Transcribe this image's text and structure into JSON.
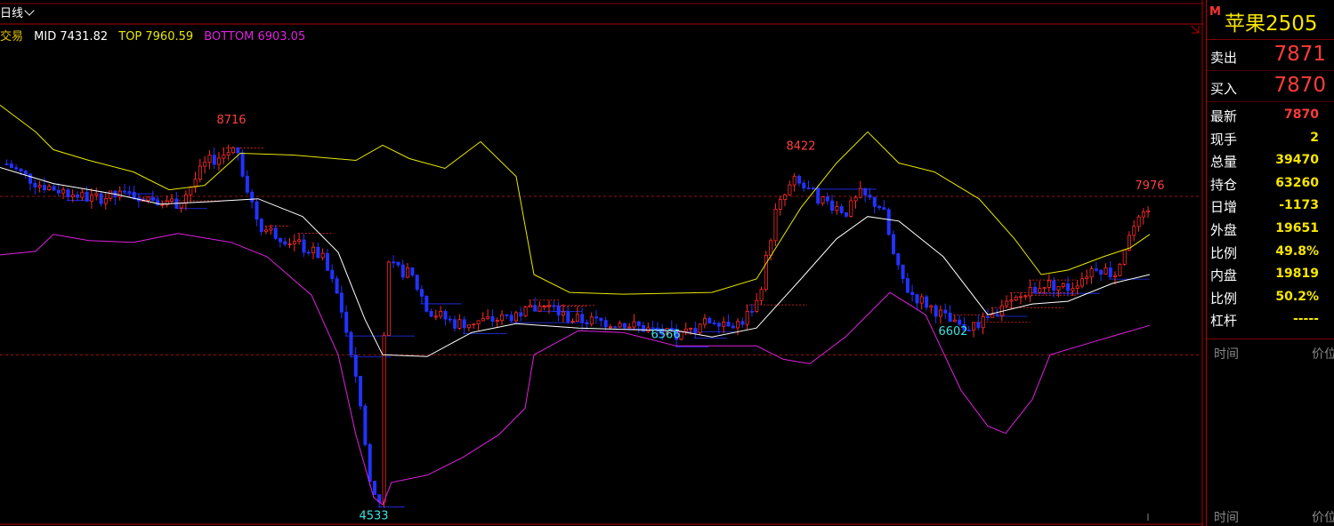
{
  "toolbar": {
    "period_label": "日线"
  },
  "legend": {
    "name": "交易",
    "mid": "MID 7431.82",
    "top": "TOP 7960.59",
    "bottom": "BOTTOM 6903.05",
    "colors": {
      "name": "#e0c000",
      "mid": "#ffffff",
      "top": "#e8e800",
      "bottom": "#e020e0"
    }
  },
  "chart_data": {
    "type": "candlestick",
    "indicator": "BOLL",
    "ylim": [
      4400,
      9700
    ],
    "price_lines": [
      7976,
      6200
    ],
    "candle_colors": {
      "up": "#ff2a2a",
      "down": "#2233ff"
    },
    "annotations": [
      {
        "label": "8716",
        "x": 260,
        "value": 8716,
        "color": "#ff4040"
      },
      {
        "label": "4533",
        "x": 420,
        "value": 4533,
        "color": "#40e0e0"
      },
      {
        "label": "6566",
        "x": 748,
        "value": 6566,
        "color": "#40e0e0"
      },
      {
        "label": "8422",
        "x": 900,
        "value": 8422,
        "color": "#ff4040"
      },
      {
        "label": "6602",
        "x": 1071,
        "value": 6602,
        "color": "#40e0e0"
      },
      {
        "label": "7976",
        "x": 1292,
        "value": 7976,
        "color": "#ff4040"
      }
    ],
    "close": [
      [
        0,
        8380
      ],
      [
        40,
        8120
      ],
      [
        100,
        7950
      ],
      [
        150,
        8000
      ],
      [
        200,
        7900
      ],
      [
        230,
        8350
      ],
      [
        265,
        8520
      ],
      [
        275,
        8100
      ],
      [
        290,
        7650
      ],
      [
        330,
        7450
      ],
      [
        360,
        7300
      ],
      [
        380,
        6800
      ],
      [
        400,
        5900
      ],
      [
        415,
        4700
      ],
      [
        425,
        4550
      ],
      [
        432,
        7200
      ],
      [
        460,
        7100
      ],
      [
        480,
        6700
      ],
      [
        510,
        6550
      ],
      [
        560,
        6600
      ],
      [
        610,
        6750
      ],
      [
        640,
        6600
      ],
      [
        700,
        6550
      ],
      [
        740,
        6450
      ],
      [
        760,
        6400
      ],
      [
        800,
        6600
      ],
      [
        830,
        6550
      ],
      [
        850,
        6800
      ],
      [
        870,
        7800
      ],
      [
        890,
        8150
      ],
      [
        920,
        7950
      ],
      [
        950,
        7800
      ],
      [
        965,
        8000
      ],
      [
        990,
        7850
      ],
      [
        1005,
        7200
      ],
      [
        1020,
        6900
      ],
      [
        1050,
        6700
      ],
      [
        1075,
        6500
      ],
      [
        1100,
        6550
      ],
      [
        1130,
        6750
      ],
      [
        1170,
        7000
      ],
      [
        1200,
        6950
      ],
      [
        1230,
        7200
      ],
      [
        1250,
        7100
      ],
      [
        1270,
        7600
      ],
      [
        1290,
        7800
      ]
    ],
    "boll_top": [
      [
        0,
        9000
      ],
      [
        40,
        8700
      ],
      [
        60,
        8500
      ],
      [
        100,
        8380
      ],
      [
        150,
        8250
      ],
      [
        190,
        8050
      ],
      [
        230,
        8100
      ],
      [
        270,
        8460
      ],
      [
        330,
        8440
      ],
      [
        400,
        8380
      ],
      [
        430,
        8550
      ],
      [
        460,
        8400
      ],
      [
        500,
        8290
      ],
      [
        540,
        8590
      ],
      [
        580,
        8200
      ],
      [
        600,
        7100
      ],
      [
        640,
        6900
      ],
      [
        700,
        6880
      ],
      [
        800,
        6900
      ],
      [
        850,
        7050
      ],
      [
        900,
        7850
      ],
      [
        940,
        8350
      ],
      [
        975,
        8700
      ],
      [
        1010,
        8350
      ],
      [
        1050,
        8250
      ],
      [
        1100,
        7950
      ],
      [
        1140,
        7500
      ],
      [
        1170,
        7100
      ],
      [
        1200,
        7150
      ],
      [
        1240,
        7300
      ],
      [
        1270,
        7400
      ],
      [
        1292,
        7550
      ]
    ],
    "boll_mid": [
      [
        0,
        8300
      ],
      [
        60,
        8120
      ],
      [
        130,
        8000
      ],
      [
        180,
        7890
      ],
      [
        240,
        7920
      ],
      [
        290,
        7950
      ],
      [
        340,
        7750
      ],
      [
        380,
        7350
      ],
      [
        410,
        6600
      ],
      [
        430,
        6200
      ],
      [
        480,
        6180
      ],
      [
        530,
        6450
      ],
      [
        580,
        6550
      ],
      [
        650,
        6500
      ],
      [
        720,
        6480
      ],
      [
        760,
        6470
      ],
      [
        800,
        6400
      ],
      [
        850,
        6500
      ],
      [
        900,
        7050
      ],
      [
        940,
        7500
      ],
      [
        975,
        7750
      ],
      [
        1010,
        7700
      ],
      [
        1060,
        7300
      ],
      [
        1110,
        6650
      ],
      [
        1160,
        6770
      ],
      [
        1200,
        6800
      ],
      [
        1250,
        7000
      ],
      [
        1292,
        7100
      ]
    ],
    "boll_bottom": [
      [
        0,
        7320
      ],
      [
        40,
        7360
      ],
      [
        60,
        7550
      ],
      [
        100,
        7480
      ],
      [
        150,
        7460
      ],
      [
        200,
        7560
      ],
      [
        260,
        7460
      ],
      [
        300,
        7300
      ],
      [
        350,
        6870
      ],
      [
        380,
        6200
      ],
      [
        400,
        5300
      ],
      [
        420,
        4600
      ],
      [
        430,
        4520
      ],
      [
        440,
        4770
      ],
      [
        480,
        4850
      ],
      [
        520,
        5050
      ],
      [
        560,
        5300
      ],
      [
        590,
        5600
      ],
      [
        600,
        6200
      ],
      [
        650,
        6470
      ],
      [
        700,
        6450
      ],
      [
        760,
        6300
      ],
      [
        850,
        6300
      ],
      [
        880,
        6150
      ],
      [
        910,
        6100
      ],
      [
        950,
        6400
      ],
      [
        1000,
        6900
      ],
      [
        1040,
        6650
      ],
      [
        1080,
        5800
      ],
      [
        1110,
        5400
      ],
      [
        1130,
        5320
      ],
      [
        1160,
        5700
      ],
      [
        1180,
        6200
      ],
      [
        1230,
        6350
      ],
      [
        1292,
        6530
      ]
    ]
  },
  "panel": {
    "symbol_mark": "M",
    "symbol": "苹果2505",
    "sell_label": "卖出",
    "sell_value": "7871",
    "buy_label": "买入",
    "buy_value": "7870",
    "stats": [
      {
        "label": "最新",
        "value": "7870",
        "color": "#ff3b3b"
      },
      {
        "label": "现手",
        "value": "2",
        "color": "#f7e600"
      },
      {
        "label": "总量",
        "value": "39470",
        "color": "#f7e600"
      },
      {
        "label": "持仓",
        "value": "63260",
        "color": "#f7e600"
      },
      {
        "label": "日增",
        "value": "-1173",
        "color": "#f7e600"
      },
      {
        "label": "外盘",
        "value": "19651",
        "color": "#f7e600"
      },
      {
        "label": "比例",
        "value": "49.8%",
        "color": "#f7e600"
      },
      {
        "label": "内盘",
        "value": "19819",
        "color": "#f7e600"
      },
      {
        "label": "比例",
        "value": "50.2%",
        "color": "#f7e600"
      },
      {
        "label": "杠杆",
        "value": "-----",
        "color": "#f7e600"
      }
    ],
    "tick_header": {
      "time": "时间",
      "price": "价位"
    }
  }
}
